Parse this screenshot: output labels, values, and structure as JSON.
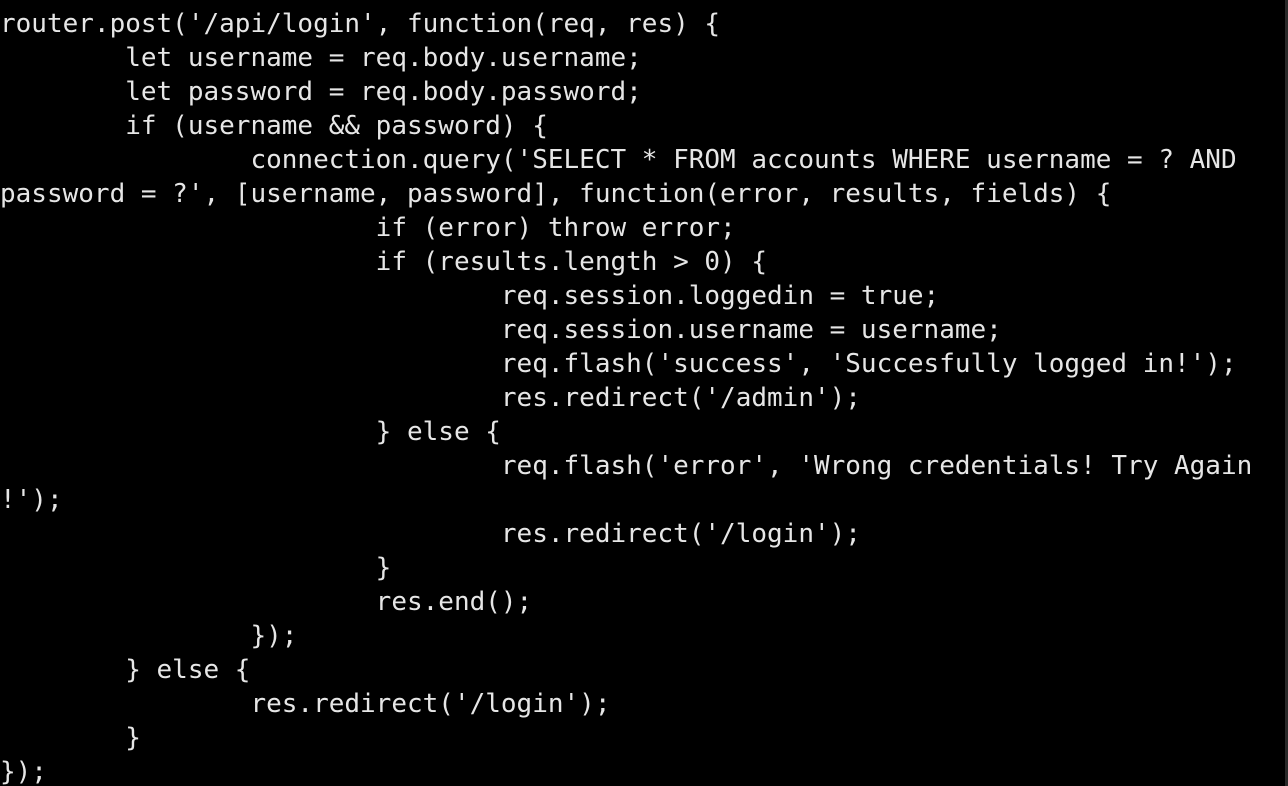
{
  "terminal": {
    "background": "#000000",
    "foreground": "#e6e6e6",
    "lines": [
      "router.post('/api/login', function(req, res) {",
      "        let username = req.body.username;",
      "        let password = req.body.password;",
      "        if (username && password) {",
      "                connection.query('SELECT * FROM accounts WHERE username = ? AND",
      "password = ?', [username, password], function(error, results, fields) {",
      "                        if (error) throw error;",
      "                        if (results.length > 0) {",
      "                                req.session.loggedin = true;",
      "                                req.session.username = username;",
      "                                req.flash('success', 'Succesfully logged in!');",
      "                                res.redirect('/admin');",
      "                        } else {",
      "                                req.flash('error', 'Wrong credentials! Try Again",
      "!');",
      "                                res.redirect('/login');",
      "                        }",
      "                        res.end();",
      "                });",
      "        } else {",
      "                res.redirect('/login');",
      "        }",
      "});"
    ]
  }
}
